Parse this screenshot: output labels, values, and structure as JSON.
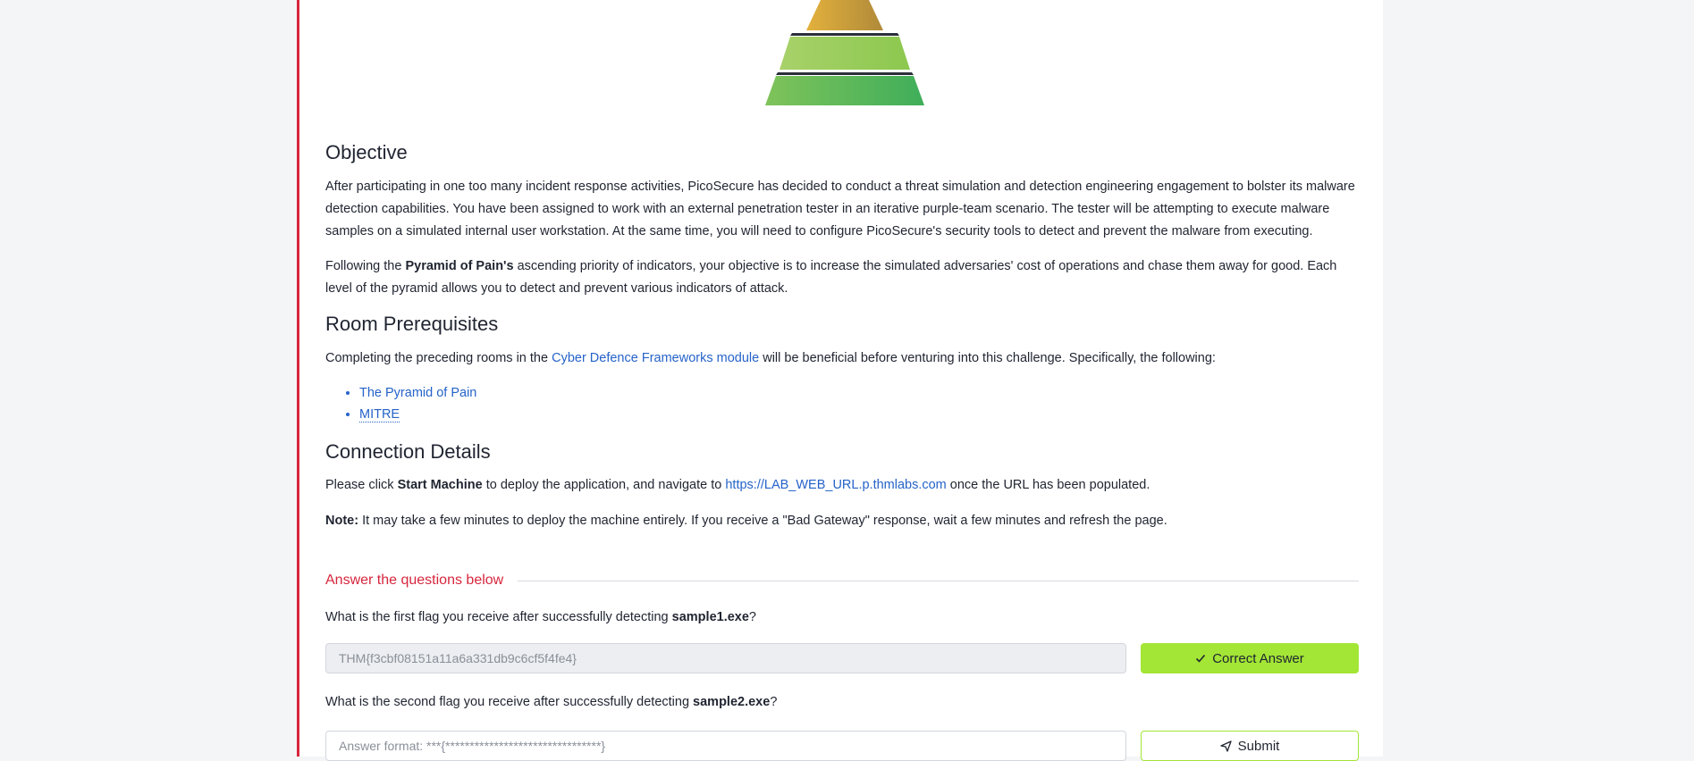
{
  "objective": {
    "heading": "Objective",
    "para1": "After participating in one too many incident response activities, PicoSecure has decided to conduct a threat simulation and detection engineering engagement to bolster its malware detection capabilities. You have been assigned to work with an external penetration tester in an iterative purple-team scenario. The tester will be attempting to execute malware samples on a simulated internal user workstation. At the same time, you will need to configure PicoSecure's security tools to detect and prevent the malware from executing.",
    "para2_prefix": "Following the ",
    "para2_bold": "Pyramid of Pain's",
    "para2_suffix": " ascending priority of indicators, your objective is to increase the simulated adversaries' cost of operations and chase them away for good. Each level of the pyramid allows you to detect and prevent various indicators of attack."
  },
  "prerequisites": {
    "heading": "Room Prerequisites",
    "text_prefix": "Completing the preceding rooms in the ",
    "module_link": "Cyber Defence Frameworks module",
    "text_suffix": " will be beneficial before venturing into this challenge. Specifically, the following:",
    "items": [
      "The Pyramid of Pain",
      "MITRE"
    ]
  },
  "connection": {
    "heading": "Connection Details",
    "text_prefix": "Please click ",
    "start_bold": "Start Machine",
    "text_mid": " to deploy the application, and navigate to ",
    "url": "https://LAB_WEB_URL.p.thmlabs.com",
    "text_suffix": " once the URL has been populated.",
    "note_label": "Note:",
    "note_text": " It may take a few minutes to deploy the machine entirely. If you receive a \"Bad Gateway\" response, wait a few minutes and refresh the page."
  },
  "questions": {
    "header": "Answer the questions below",
    "q1": {
      "prefix": "What is the first flag you receive after successfully detecting ",
      "bold": "sample1.exe",
      "suffix": "?",
      "answer": "THM{f3cbf08151a11a6a331db9c6cf5f4fe4}",
      "button": "Correct Answer"
    },
    "q2": {
      "prefix": "What is the second flag you receive after successfully detecting ",
      "bold": "sample2.exe",
      "suffix": "?",
      "placeholder": "Answer format: ***{********************************}",
      "button": "Submit"
    }
  },
  "colors": {
    "accent_red": "#d7263d",
    "link_blue": "#2563c9",
    "lime": "#a3e635"
  }
}
